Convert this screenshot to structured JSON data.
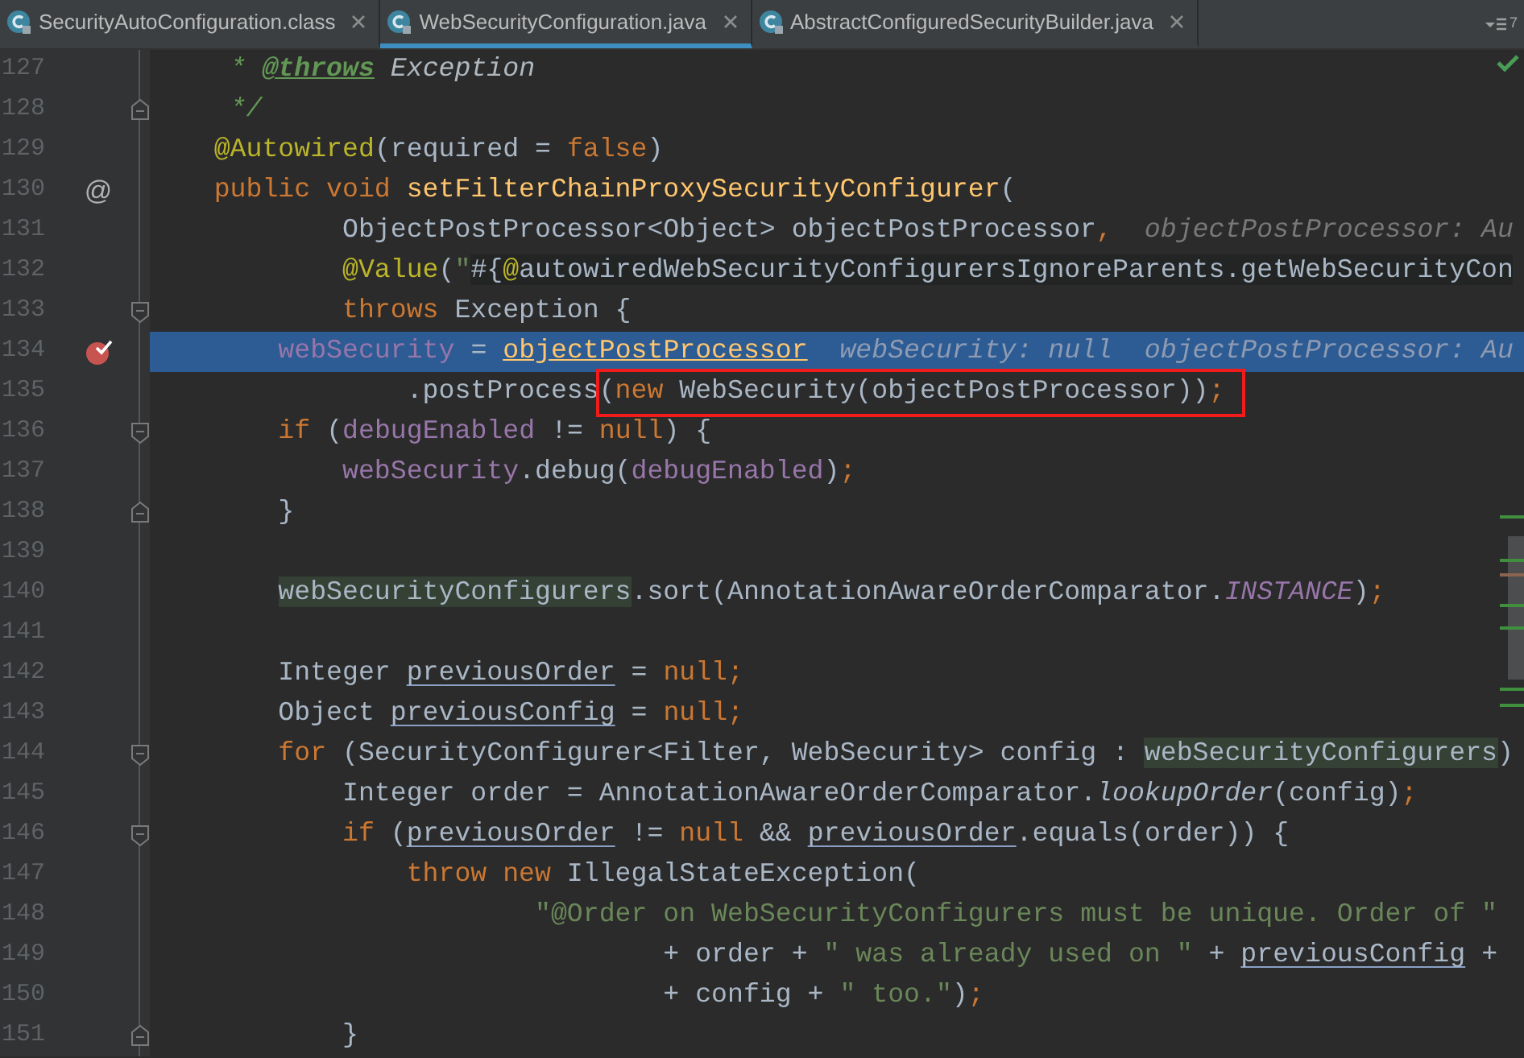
{
  "tabs": [
    {
      "label": "SecurityAutoConfiguration.class",
      "selected": false
    },
    {
      "label": "WebSecurityConfiguration.java",
      "selected": true
    },
    {
      "label": "AbstractConfiguredSecurityBuilder.java",
      "selected": false
    }
  ],
  "hidden_tabs_count": "7",
  "lines": [
    {
      "number": "127",
      "current": false,
      "breakpoint": false,
      "fold_start": false,
      "fold_end": false,
      "tokens": [
        {
          "kind": "doc",
          "text": "     * "
        },
        {
          "kind": "doctag",
          "text": "@throws"
        },
        {
          "kind": "docref",
          "text": " Exception"
        }
      ]
    },
    {
      "number": "128",
      "current": false,
      "breakpoint": false,
      "fold_start": false,
      "fold_end": true,
      "tokens": [
        {
          "kind": "doc",
          "text": "     */"
        }
      ]
    },
    {
      "number": "129",
      "current": false,
      "breakpoint": false,
      "fold_start": false,
      "fold_end": false,
      "tokens": [
        {
          "kind": "annot",
          "text": "    @Autowired"
        },
        {
          "kind": "plain",
          "text": "(required = "
        },
        {
          "kind": "kw",
          "text": "false"
        },
        {
          "kind": "plain",
          "text": ")"
        }
      ]
    },
    {
      "number": "130",
      "current": false,
      "breakpoint": false,
      "fold_start": false,
      "fold_end": false,
      "gutter_mark": "@",
      "tokens": [
        {
          "kind": "kw",
          "text": "    public void "
        },
        {
          "kind": "decl",
          "text": "setFilterChainProxySecurityConfigurer"
        },
        {
          "kind": "plain",
          "text": "("
        }
      ]
    },
    {
      "number": "131",
      "current": false,
      "breakpoint": false,
      "fold_start": false,
      "fold_end": false,
      "tokens": [
        {
          "kind": "plain",
          "text": "            ObjectPostProcessor<Object> objectPostProcessor"
        },
        {
          "kind": "kw",
          "text": ","
        }
      ],
      "hints": [
        "objectPostProcessor: Au"
      ]
    },
    {
      "number": "132",
      "current": false,
      "breakpoint": false,
      "fold_start": false,
      "fold_end": false,
      "tokens": [
        {
          "kind": "annot",
          "text": "            @Value"
        },
        {
          "kind": "plain",
          "text": "("
        },
        {
          "kind": "string",
          "text": "\""
        },
        {
          "kind": "injected",
          "text": "#{"
        },
        {
          "kind": "injected-annot",
          "text": "@"
        },
        {
          "kind": "injected",
          "text": "autowiredWebSecurityConfigurersIgnoreParents.getWebSecurityCon"
        }
      ]
    },
    {
      "number": "133",
      "current": false,
      "breakpoint": false,
      "fold_start": true,
      "fold_end": false,
      "tokens": [
        {
          "kind": "kw",
          "text": "            throws"
        },
        {
          "kind": "plain",
          "text": " Exception {"
        }
      ]
    },
    {
      "number": "134",
      "current": true,
      "breakpoint": true,
      "fold_start": false,
      "fold_end": false,
      "tokens": [
        {
          "kind": "field",
          "text": "        webSecurity"
        },
        {
          "kind": "plain",
          "text": " = "
        },
        {
          "kind": "focus",
          "text": "objectPostProcessor"
        }
      ],
      "hints": [
        "webSecurity: null",
        "objectPostProcessor: Au"
      ]
    },
    {
      "number": "135",
      "current": false,
      "breakpoint": false,
      "fold_start": false,
      "fold_end": false,
      "tokens": [
        {
          "kind": "plain",
          "text": "                .postProcess"
        },
        {
          "kind": "box",
          "children": [
            {
              "kind": "plain",
              "text": "("
            },
            {
              "kind": "kw",
              "text": "new"
            },
            {
              "kind": "plain",
              "text": " WebSecurity(objectPostProcessor))"
            },
            {
              "kind": "kw",
              "text": ";"
            }
          ]
        }
      ]
    },
    {
      "number": "136",
      "current": false,
      "breakpoint": false,
      "fold_start": true,
      "fold_end": false,
      "tokens": [
        {
          "kind": "kw",
          "text": "        if"
        },
        {
          "kind": "plain",
          "text": " ("
        },
        {
          "kind": "field",
          "text": "debugEnabled"
        },
        {
          "kind": "plain",
          "text": " != "
        },
        {
          "kind": "kw",
          "text": "null"
        },
        {
          "kind": "plain",
          "text": ") {"
        }
      ]
    },
    {
      "number": "137",
      "current": false,
      "breakpoint": false,
      "fold_start": false,
      "fold_end": false,
      "tokens": [
        {
          "kind": "field",
          "text": "            webSecurity"
        },
        {
          "kind": "plain",
          "text": ".debug("
        },
        {
          "kind": "field",
          "text": "debugEnabled"
        },
        {
          "kind": "plain",
          "text": ")"
        },
        {
          "kind": "kw",
          "text": ";"
        }
      ]
    },
    {
      "number": "138",
      "current": false,
      "breakpoint": false,
      "fold_start": false,
      "fold_end": true,
      "tokens": [
        {
          "kind": "plain",
          "text": "        }"
        }
      ]
    },
    {
      "number": "139",
      "current": false,
      "breakpoint": false,
      "fold_start": false,
      "fold_end": false
    },
    {
      "number": "140",
      "current": false,
      "breakpoint": false,
      "fold_start": false,
      "fold_end": false,
      "tokens": [
        {
          "kind": "usage",
          "text": "        webSecurityConfigurers"
        },
        {
          "kind": "plain",
          "text": ".sort(AnnotationAwareOrderComparator."
        },
        {
          "kind": "static",
          "text": "INSTANCE"
        },
        {
          "kind": "plain",
          "text": ")"
        },
        {
          "kind": "kw",
          "text": ";"
        }
      ]
    },
    {
      "number": "141",
      "current": false,
      "breakpoint": false,
      "fold_start": false,
      "fold_end": false
    },
    {
      "number": "142",
      "current": false,
      "breakpoint": false,
      "fold_start": false,
      "fold_end": false,
      "tokens": [
        {
          "kind": "plain",
          "text": "        Integer "
        },
        {
          "kind": "reassigned",
          "text": "previousOrder"
        },
        {
          "kind": "plain",
          "text": " = "
        },
        {
          "kind": "kw",
          "text": "null;"
        }
      ]
    },
    {
      "number": "143",
      "current": false,
      "breakpoint": false,
      "fold_start": false,
      "fold_end": false,
      "tokens": [
        {
          "kind": "plain",
          "text": "        Object "
        },
        {
          "kind": "reassigned",
          "text": "previousConfig"
        },
        {
          "kind": "plain",
          "text": " = "
        },
        {
          "kind": "kw",
          "text": "null;"
        }
      ]
    },
    {
      "number": "144",
      "current": false,
      "breakpoint": false,
      "fold_start": true,
      "fold_end": false,
      "tokens": [
        {
          "kind": "kw",
          "text": "        for"
        },
        {
          "kind": "plain",
          "text": " (SecurityConfigurer<Filter, WebSecurity> config : "
        },
        {
          "kind": "usage",
          "text": "webSecurityConfigurers"
        },
        {
          "kind": "plain",
          "text": ")"
        }
      ]
    },
    {
      "number": "145",
      "current": false,
      "breakpoint": false,
      "fold_start": false,
      "fold_end": false,
      "tokens": [
        {
          "kind": "plain",
          "text": "            Integer order = AnnotationAwareOrderComparator."
        },
        {
          "kind": "italic",
          "text": "lookupOrder"
        },
        {
          "kind": "plain",
          "text": "(config)"
        },
        {
          "kind": "kw",
          "text": ";"
        }
      ]
    },
    {
      "number": "146",
      "current": false,
      "breakpoint": false,
      "fold_start": true,
      "fold_end": false,
      "tokens": [
        {
          "kind": "kw",
          "text": "            if"
        },
        {
          "kind": "plain",
          "text": " ("
        },
        {
          "kind": "reassigned",
          "text": "previousOrder"
        },
        {
          "kind": "plain",
          "text": " != "
        },
        {
          "kind": "kw",
          "text": "null"
        },
        {
          "kind": "plain",
          "text": " && "
        },
        {
          "kind": "reassigned",
          "text": "previousOrder"
        },
        {
          "kind": "plain",
          "text": ".equals(order)) {"
        }
      ]
    },
    {
      "number": "147",
      "current": false,
      "breakpoint": false,
      "fold_start": false,
      "fold_end": false,
      "tokens": [
        {
          "kind": "kw",
          "text": "                throw new"
        },
        {
          "kind": "plain",
          "text": " IllegalStateException("
        }
      ]
    },
    {
      "number": "148",
      "current": false,
      "breakpoint": false,
      "fold_start": false,
      "fold_end": false,
      "tokens": [
        {
          "kind": "string",
          "text": "                        \"@Order on WebSecurityConfigurers must be unique. Order of \""
        }
      ]
    },
    {
      "number": "149",
      "current": false,
      "breakpoint": false,
      "fold_start": false,
      "fold_end": false,
      "tokens": [
        {
          "kind": "plain",
          "text": "                                + order + "
        },
        {
          "kind": "string",
          "text": "\" was already used on \""
        },
        {
          "kind": "plain",
          "text": " + "
        },
        {
          "kind": "reassigned",
          "text": "previousConfig"
        },
        {
          "kind": "plain",
          "text": " +"
        }
      ]
    },
    {
      "number": "150",
      "current": false,
      "breakpoint": false,
      "fold_start": false,
      "fold_end": false,
      "tokens": [
        {
          "kind": "plain",
          "text": "                                + config + "
        },
        {
          "kind": "string",
          "text": "\" too.\""
        },
        {
          "kind": "plain",
          "text": ")"
        },
        {
          "kind": "kw",
          "text": ";"
        }
      ]
    },
    {
      "number": "151",
      "current": false,
      "breakpoint": false,
      "fold_start": false,
      "fold_end": true,
      "tokens": [
        {
          "kind": "plain",
          "text": "            }"
        }
      ]
    }
  ]
}
